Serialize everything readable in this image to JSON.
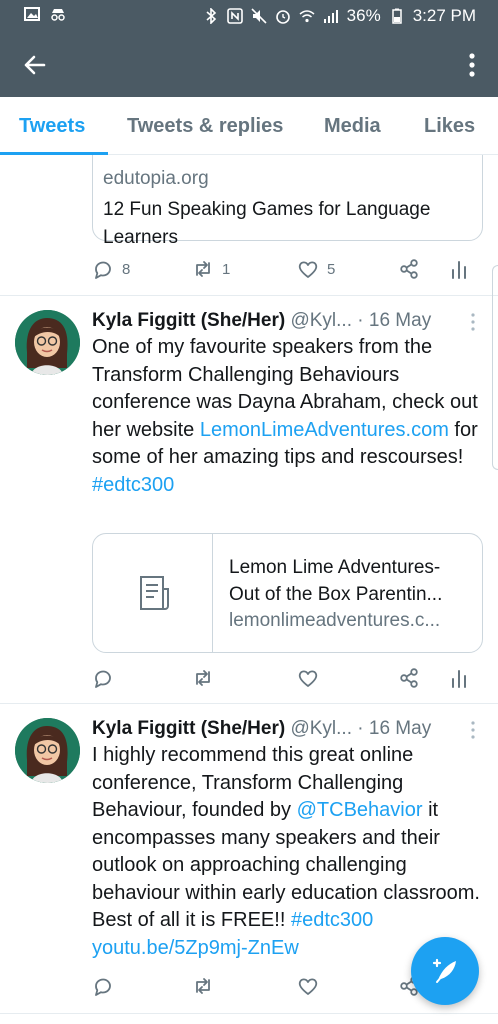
{
  "status_bar": {
    "battery": "36%",
    "time": "3:27 PM"
  },
  "tabs": [
    {
      "label": "Tweets",
      "active": true
    },
    {
      "label": "Tweets & replies",
      "active": false
    },
    {
      "label": "Media",
      "active": false
    },
    {
      "label": "Likes",
      "active": false
    }
  ],
  "tweet0": {
    "card": {
      "domain": "edutopia.org",
      "title": "12 Fun Speaking Games for Language Learners"
    },
    "counts": {
      "replies": "8",
      "retweets": "1",
      "likes": "5"
    }
  },
  "tweet1": {
    "name": "Kyla Figgitt (She/Her)",
    "handle": "@Kyl...",
    "date": "· 16 May",
    "text_a": "One of my favourite speakers from the Transform Challenging Behaviours conference was Dayna Abraham, check out her website ",
    "link1": "LemonLimeAdventures.com",
    "text_b": " for some of her amazing tips and rescourses! ",
    "hashtag": "#edtc300",
    "card": {
      "title_line1": "Lemon Lime Adventures-",
      "title_line2": "Out of the Box Parentin...",
      "domain": "lemonlimeadventures.c..."
    }
  },
  "tweet2": {
    "name": "Kyla Figgitt (She/Her)",
    "handle": "@Kyl...",
    "date": "· 16 May",
    "text_a": "I highly recommend this great online conference, Transform Challenging Behaviour, founded by ",
    "mention": "@TCBehavior",
    "text_b": " it encompasses many speakers and their outlook on approaching challenging behaviour within early education classroom. Best of all it is FREE!! ",
    "hashtag": "#edtc300",
    "link": "youtu.be/5Zp9mj-ZnEw"
  },
  "colors": {
    "accent": "#1da1f2",
    "appbar": "#4b5a64",
    "muted": "#66757f"
  }
}
